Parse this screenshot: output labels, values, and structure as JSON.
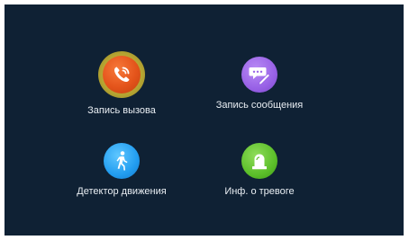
{
  "menu": {
    "items": [
      {
        "label": "Запись вызова",
        "icon": "phone-call-icon",
        "color": "#e4541b",
        "selected": true
      },
      {
        "label": "Запись сообщения",
        "icon": "message-edit-icon",
        "color": "#9861e6",
        "selected": false
      },
      {
        "label": "Детектор движения",
        "icon": "walking-person-icon",
        "color": "#229df0",
        "selected": false
      },
      {
        "label": "Инф. о тревоге",
        "icon": "alarm-siren-icon",
        "color": "#5cbf2a",
        "selected": false
      }
    ]
  },
  "colors": {
    "background": "#0f2134",
    "selection_ring": "#c9b640",
    "label_text": "#e9eef3"
  }
}
